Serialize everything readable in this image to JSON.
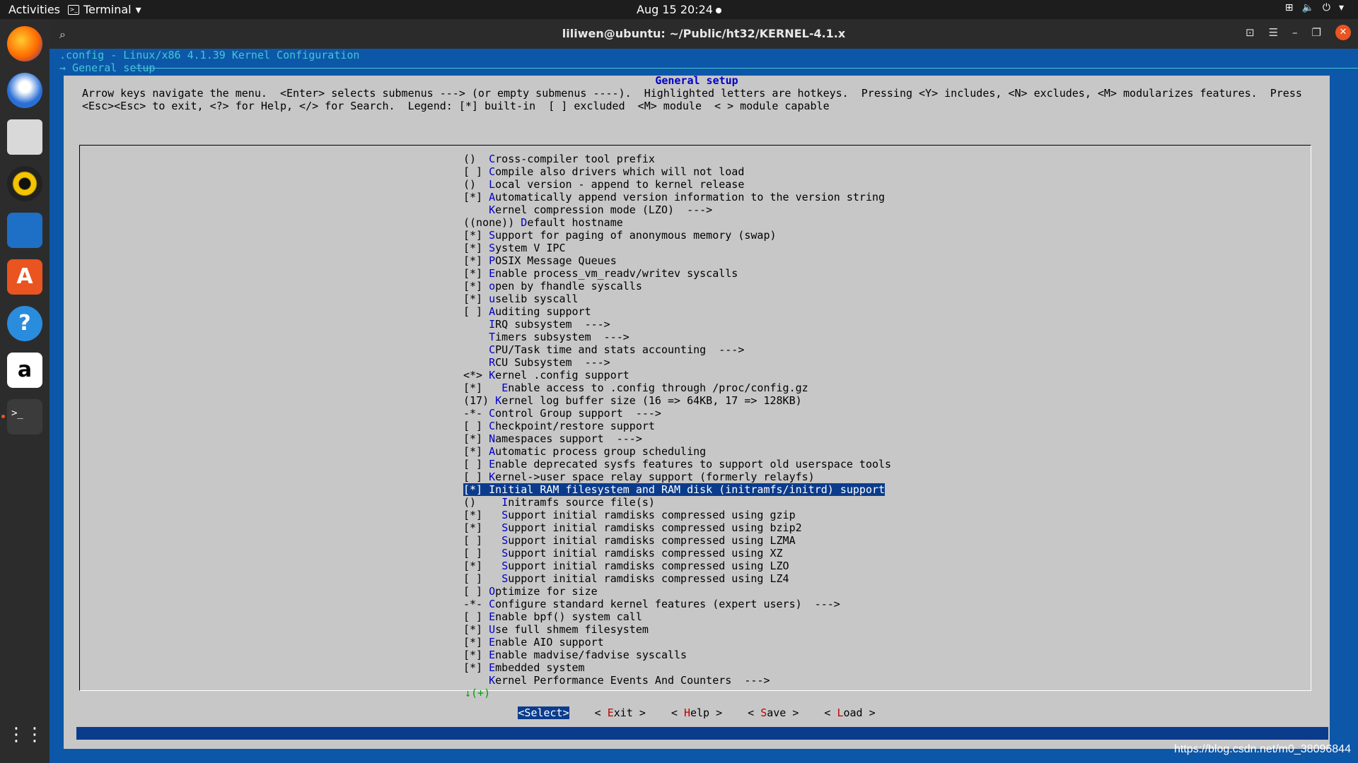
{
  "topbar": {
    "activities": "Activities",
    "app_name": "Terminal",
    "clock": "Aug 15  20:24"
  },
  "dock": {
    "apps": [
      "firefox-icon",
      "thunderbird-icon",
      "files-icon",
      "rhythmbox-icon",
      "writer-icon",
      "software-icon",
      "help-icon",
      "amazon-icon",
      "terminal-icon",
      "show-apps-icon"
    ]
  },
  "window": {
    "title": "liliwen@ubuntu: ~/Public/ht32/KERNEL-4.1.x"
  },
  "term": {
    "header1": ".config - Linux/x86 4.1.39 Kernel Configuration",
    "header2": "→ General setup"
  },
  "dialog": {
    "title": "General setup",
    "help_line1": "Arrow keys navigate the menu.  <Enter> selects submenus ---> (or empty submenus ----).  Highlighted letters are hotkeys.  Pressing <Y> includes, <N> excludes, <M> modularizes features.  Press",
    "help_line2": "<Esc><Esc> to exit, <?> for Help, </> for Search.  Legend: [*] built-in  [ ] excluded  <M> module  < > module capable",
    "menu": [
      {
        "prefix": "()  ",
        "hk": "C",
        "rest": "ross-compiler tool prefix"
      },
      {
        "prefix": "[ ] ",
        "hk": "C",
        "rest": "ompile also drivers which will not load"
      },
      {
        "prefix": "()  ",
        "hk": "L",
        "rest": "ocal version - append to kernel release"
      },
      {
        "prefix": "[*] ",
        "hk": "A",
        "rest": "utomatically append version information to the version string"
      },
      {
        "prefix": "    ",
        "hk": "K",
        "rest": "ernel compression mode (LZO)  --->"
      },
      {
        "prefix": "((none)) ",
        "hk": "D",
        "rest": "efault hostname"
      },
      {
        "prefix": "[*] ",
        "hk": "S",
        "rest": "upport for paging of anonymous memory (swap)"
      },
      {
        "prefix": "[*] ",
        "hk": "S",
        "rest": "ystem V IPC"
      },
      {
        "prefix": "[*] ",
        "hk": "P",
        "rest": "OSIX Message Queues"
      },
      {
        "prefix": "[*] ",
        "hk": "E",
        "rest": "nable process_vm_readv/writev syscalls"
      },
      {
        "prefix": "[*] ",
        "hk": "o",
        "rest": "pen by fhandle syscalls"
      },
      {
        "prefix": "[*] ",
        "hk": "u",
        "rest": "selib syscall"
      },
      {
        "prefix": "[ ] ",
        "hk": "A",
        "rest": "uditing support"
      },
      {
        "prefix": "    ",
        "hk": "I",
        "rest": "RQ subsystem  --->"
      },
      {
        "prefix": "    ",
        "hk": "T",
        "rest": "imers subsystem  --->"
      },
      {
        "prefix": "    ",
        "hk": "C",
        "rest": "PU/Task time and stats accounting  --->"
      },
      {
        "prefix": "    ",
        "hk": "R",
        "rest": "CU Subsystem  --->"
      },
      {
        "prefix": "<*> ",
        "hk": "K",
        "rest": "ernel .config support"
      },
      {
        "prefix": "[*]   ",
        "hk": "E",
        "rest": "nable access to .config through /proc/config.gz"
      },
      {
        "prefix": "(17) ",
        "hk": "K",
        "rest": "ernel log buffer size (16 => 64KB, 17 => 128KB)"
      },
      {
        "prefix": "-*- ",
        "hk": "C",
        "rest": "ontrol Group support  --->"
      },
      {
        "prefix": "[ ] ",
        "hk": "C",
        "rest": "heckpoint/restore support"
      },
      {
        "prefix": "[*] ",
        "hk": "N",
        "rest": "amespaces support  --->"
      },
      {
        "prefix": "[*] ",
        "hk": "A",
        "rest": "utomatic process group scheduling"
      },
      {
        "prefix": "[ ] ",
        "hk": "E",
        "rest": "nable deprecated sysfs features to support old userspace tools"
      },
      {
        "prefix": "[ ] ",
        "hk": "K",
        "rest": "ernel->user space relay support (formerly relayfs)"
      },
      {
        "prefix": "[*] ",
        "hk": "I",
        "rest": "nitial RAM filesystem and RAM disk (initramfs/initrd) support",
        "selected": true
      },
      {
        "prefix": "()    ",
        "hk": "I",
        "rest": "nitramfs source file(s)"
      },
      {
        "prefix": "[*]   ",
        "hk": "S",
        "rest": "upport initial ramdisks compressed using gzip"
      },
      {
        "prefix": "[*]   ",
        "hk": "S",
        "rest": "upport initial ramdisks compressed using bzip2"
      },
      {
        "prefix": "[ ]   ",
        "hk": "S",
        "rest": "upport initial ramdisks compressed using LZMA"
      },
      {
        "prefix": "[ ]   ",
        "hk": "S",
        "rest": "upport initial ramdisks compressed using XZ"
      },
      {
        "prefix": "[*]   ",
        "hk": "S",
        "rest": "upport initial ramdisks compressed using LZO"
      },
      {
        "prefix": "[ ]   ",
        "hk": "S",
        "rest": "upport initial ramdisks compressed using LZ4"
      },
      {
        "prefix": "[ ] ",
        "hk": "O",
        "rest": "ptimize for size"
      },
      {
        "prefix": "-*- ",
        "hk": "C",
        "rest": "onfigure standard kernel features (expert users)  --->"
      },
      {
        "prefix": "[ ] ",
        "hk": "E",
        "rest": "nable bpf() system call"
      },
      {
        "prefix": "[*] ",
        "hk": "U",
        "rest": "se full shmem filesystem"
      },
      {
        "prefix": "[*] ",
        "hk": "E",
        "rest": "nable AIO support"
      },
      {
        "prefix": "[*] ",
        "hk": "E",
        "rest": "nable madvise/fadvise syscalls"
      },
      {
        "prefix": "[*] ",
        "hk": "E",
        "rest": "mbedded system"
      },
      {
        "prefix": "    ",
        "hk": "K",
        "rest": "ernel Performance Events And Counters  --->"
      }
    ],
    "more_indicator": "↓(+)",
    "buttons": [
      {
        "pre": "<",
        "hk": "S",
        "post": "elect>",
        "active": true
      },
      {
        "pre": "< ",
        "hk": "E",
        "post": "xit >",
        "active": false
      },
      {
        "pre": "< ",
        "hk": "H",
        "post": "elp >",
        "active": false
      },
      {
        "pre": "< ",
        "hk": "S",
        "post": "ave >",
        "active": false
      },
      {
        "pre": "< ",
        "hk": "L",
        "post": "oad >",
        "active": false
      }
    ]
  },
  "watermark": "https://blog.csdn.net/m0_38096844",
  "colors": {
    "terminal_bg": "#0d57a8",
    "dialog_bg": "#c7c7c7",
    "selection_bg": "#0b3c8c",
    "hotkey": "#0000c8",
    "button_hotkey": "#c00000",
    "accent": "#e95420"
  }
}
